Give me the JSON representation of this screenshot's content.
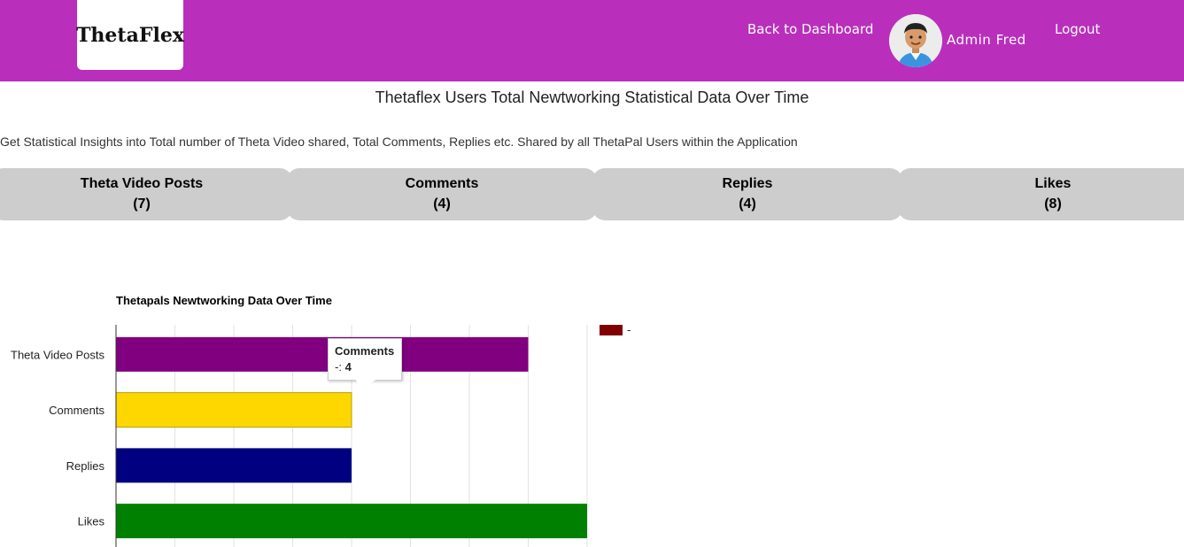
{
  "header": {
    "logo": "ThetaFlex",
    "back_link": "Back to Dashboard",
    "user_name": "Admin Fred",
    "logout": "Logout"
  },
  "page": {
    "title": "Thetaflex Users Total Newtworking Statistical Data Over Time",
    "subtitle": "Get Statistical Insights into Total number of Theta Video shared, Total Comments, Replies etc. Shared by all ThetaPal Users within the Application"
  },
  "stats": [
    {
      "label": "Theta Video Posts",
      "count": "(7)"
    },
    {
      "label": "Comments",
      "count": "(4)"
    },
    {
      "label": "Replies",
      "count": "(4)"
    },
    {
      "label": "Likes",
      "count": "(8)"
    }
  ],
  "colors": {
    "header": "#b92fbb",
    "card": "#cdcdcd",
    "legend": "#800000"
  },
  "tooltip": {
    "title": "Comments",
    "value_prefix": "-: ",
    "value": "4"
  },
  "chart_data": {
    "type": "bar",
    "orientation": "horizontal",
    "title": "Thetapals Newtworking Data Over Time",
    "categories": [
      "Theta Video Posts",
      "Comments",
      "Replies",
      "Likes"
    ],
    "values": [
      7,
      4,
      4,
      8
    ],
    "bar_colors": [
      "#800080",
      "#ffd700",
      "#000080",
      "#008000"
    ],
    "legend": [
      {
        "name": "-",
        "color": "#800000"
      }
    ],
    "legend_position": "right",
    "xlim": [
      0,
      8
    ],
    "grid": true
  }
}
